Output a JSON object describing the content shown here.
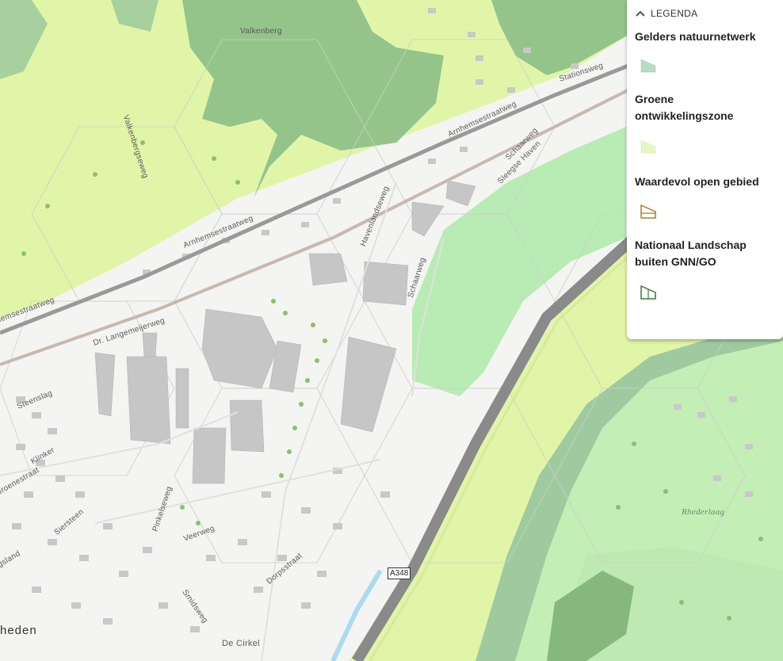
{
  "legend": {
    "title": "LEGENDA",
    "items": [
      {
        "label": "Gelders natuurnetwerk",
        "icon": "dark-green-swatch-icon",
        "color": "#b7dcc0"
      },
      {
        "label": "Groene ontwikkelingszone",
        "icon": "light-green-swatch-icon",
        "color": "#e6f7c1"
      },
      {
        "label": "Waardevol open gebied",
        "icon": "open-area-hatch-icon",
        "color": "#b07a2a"
      },
      {
        "label": "Nationaal Landschap buiten GNN/GO",
        "icon": "landscape-hatch-icon",
        "color": "#3a7a3a"
      }
    ]
  },
  "map": {
    "colors": {
      "ontwikkelingszone": "#e1f5a8",
      "natuurnetwerk": "#94c48a",
      "water_zone": "#b8ecb4",
      "road": "#8a8a8a",
      "building": "#c6c6c6"
    },
    "labels": {
      "valkenberg": "Valkenberg",
      "valkenbergseweg": "Valkenbergseweg",
      "stationsweg": "Stationsweg",
      "arnhemsestraatweg_1": "Arnhemsestraatweg",
      "arnhemsestraatweg_2": "Arnhemsestraatweg",
      "arnhemsestraatweg_3": "Arnhemsestraatweg",
      "schaarweg_1": "Schaarweg",
      "schaarweg_2": "Schaarweg",
      "sleegse_haven": "Sleegse Haven",
      "havenlandseweg": "Havenlandseweg",
      "dr_langemeijerweg": "Dr. Langemeijerweg",
      "steenslag": "Steenslag",
      "klinker": "Klinker",
      "groenestraat": "Groenestraat",
      "siersteen": "Siersteen",
      "pinkelseweg": "Pinkelseweg",
      "veerweg": "Veerweg",
      "dorpsstraat": "Dorpsstraat",
      "smidsweg": "Smidsweg",
      "de_cirkel": "De Cirkel",
      "rhederlaag": "Rhederlaag",
      "town": "heden",
      "gsland": "gsland",
      "road_number": "A348"
    }
  }
}
